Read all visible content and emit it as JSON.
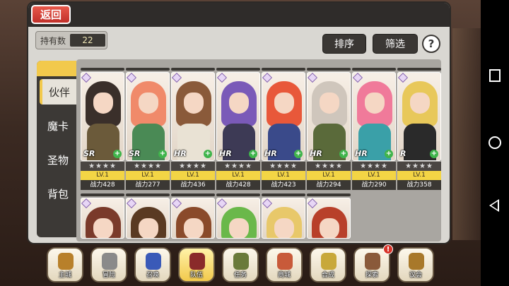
{
  "header": {
    "back_label": "返回"
  },
  "owned": {
    "label": "持有数",
    "count": "22"
  },
  "toolbar": {
    "sort_label": "排序",
    "filter_label": "筛选",
    "help_label": "?"
  },
  "tabs": [
    {
      "label": "伙伴",
      "active": true
    },
    {
      "label": "魔卡",
      "active": false
    },
    {
      "label": "圣物",
      "active": false
    },
    {
      "label": "背包",
      "active": false
    }
  ],
  "cards": [
    {
      "rarity": "SR",
      "stars": "★★★★",
      "level": "LV.1",
      "power": "战力428",
      "hair": "#3a2f2a",
      "outfit": "#6b5a3a"
    },
    {
      "rarity": "SR",
      "stars": "★★★★",
      "level": "LV.1",
      "power": "战力277",
      "hair": "#f08a6a",
      "outfit": "#4a8a55"
    },
    {
      "rarity": "HR",
      "stars": "★★★★",
      "level": "LV.1",
      "power": "战力436",
      "hair": "#8a5a3a",
      "outfit": "#e9e2d4"
    },
    {
      "rarity": "HR",
      "stars": "★★★★",
      "level": "LV.1",
      "power": "战力428",
      "hair": "#7a5ab8",
      "outfit": "#3d3a55"
    },
    {
      "rarity": "HR",
      "stars": "★★★★",
      "level": "LV.1",
      "power": "战力423",
      "hair": "#e8583a",
      "outfit": "#3a4a8a"
    },
    {
      "rarity": "HR",
      "stars": "★★★★",
      "level": "LV.1",
      "power": "战力294",
      "hair": "#cfc6bc",
      "outfit": "#5a6a3a"
    },
    {
      "rarity": "HR",
      "stars": "★★★★",
      "level": "LV.1",
      "power": "战力290",
      "hair": "#f07a9a",
      "outfit": "#3aa0a8"
    },
    {
      "rarity": "R",
      "stars": "★★★★",
      "level": "LV.1",
      "power": "战力358",
      "hair": "#e8c85a",
      "outfit": "#2a2a2a"
    }
  ],
  "cards_row2": [
    {
      "hair": "#7a3a2a",
      "outfit": "#8a6a4a"
    },
    {
      "hair": "#5a3a22",
      "outfit": "#6a7a8a"
    },
    {
      "hair": "#8a4a2a",
      "outfit": "#c8a070"
    },
    {
      "hair": "#6ab84a",
      "outfit": "#5a8a3a"
    },
    {
      "hair": "#e8c86a",
      "outfit": "#c88a5a"
    },
    {
      "hair": "#b8402a",
      "outfit": "#8a3a3a"
    }
  ],
  "bottom_nav": [
    {
      "label": "主城",
      "icon": "castle-icon",
      "color": "#b8802a",
      "active": false,
      "alert": ""
    },
    {
      "label": "冒险",
      "icon": "crossed-swords-icon",
      "color": "#8a8a8a",
      "active": false,
      "alert": ""
    },
    {
      "label": "召唤",
      "icon": "summon-cards-icon",
      "color": "#3a5ab8",
      "active": false,
      "alert": ""
    },
    {
      "label": "队伍",
      "icon": "team-crest-icon",
      "color": "#8a2a2a",
      "active": true,
      "alert": ""
    },
    {
      "label": "任务",
      "icon": "quest-book-icon",
      "color": "#6a7a3a",
      "active": false,
      "alert": ""
    },
    {
      "label": "商城",
      "icon": "shop-icon",
      "color": "#c85a3a",
      "active": false,
      "alert": ""
    },
    {
      "label": "合成",
      "icon": "synthesis-icon",
      "color": "#c8a83a",
      "active": false,
      "alert": ""
    },
    {
      "label": "探索",
      "icon": "explore-bow-icon",
      "color": "#8a5a3a",
      "active": false,
      "alert": "!"
    },
    {
      "label": "议会",
      "icon": "council-icon",
      "color": "#a8782a",
      "active": false,
      "alert": ""
    }
  ]
}
